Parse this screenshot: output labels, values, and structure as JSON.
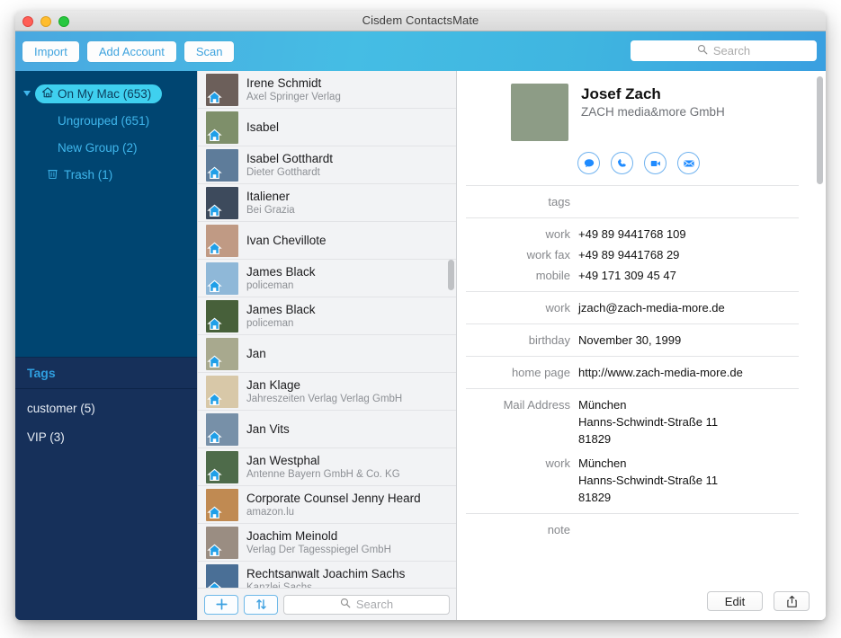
{
  "window": {
    "title": "Cisdem ContactsMate",
    "controls": [
      "close",
      "minimize",
      "zoom"
    ]
  },
  "toolbar": {
    "import_label": "Import",
    "add_account_label": "Add Account",
    "scan_label": "Scan",
    "search_placeholder": "Search",
    "search_value": "",
    "accent": "#45bde4"
  },
  "sidebar": {
    "bg": "#004571",
    "tags_bg": "#16305a",
    "accent_text": "#3fb6ec",
    "selected_chip_bg": "#3fd0ef",
    "groups": [
      {
        "label": "On My Mac (653)",
        "icon": "house-icon",
        "selected": true
      },
      {
        "label": "Ungrouped (651)",
        "selected": false
      },
      {
        "label": "New Group (2)",
        "selected": false
      },
      {
        "label": "Trash (1)",
        "icon": "trash-icon",
        "selected": false
      }
    ],
    "tags_header": "Tags",
    "tags": [
      {
        "label": "customer (5)"
      },
      {
        "label": "VIP (3)"
      }
    ]
  },
  "contact_list": {
    "items": [
      {
        "name": "Irene Schmidt",
        "org": "Axel Springer Verlag",
        "thumb": "#6c5f5a"
      },
      {
        "name": "Isabel",
        "org": "",
        "thumb": "#7e8f6a"
      },
      {
        "name": "Isabel Gotthardt",
        "org": "Dieter Gotthardt",
        "thumb": "#5e7c9a"
      },
      {
        "name": "Italiener",
        "org": "Bei Grazia",
        "thumb": "#3d4a5c"
      },
      {
        "name": "Ivan Chevillote",
        "org": "",
        "thumb": "#c09a84"
      },
      {
        "name": "James Black",
        "org": "policeman",
        "thumb": "#8fb8d8"
      },
      {
        "name": "James Black",
        "org": "policeman",
        "thumb": "#47603a"
      },
      {
        "name": "Jan",
        "org": "",
        "thumb": "#a8a98e"
      },
      {
        "name": "Jan Klage",
        "org": "Jahreszeiten Verlag Verlag GmbH",
        "thumb": "#d8c8a8"
      },
      {
        "name": "Jan Vits",
        "org": "",
        "thumb": "#7790a8"
      },
      {
        "name": "Jan Westphal",
        "org": "Antenne Bayern GmbH & Co. KG",
        "thumb": "#4e6b4a"
      },
      {
        "name": "Corporate Counsel Jenny Heard",
        "org": "amazon.lu",
        "thumb": "#c08a52"
      },
      {
        "name": "Joachim Meinold",
        "org": "Verlag Der Tagesspiegel GmbH",
        "thumb": "#9a8d82"
      },
      {
        "name": "Rechtsanwalt Joachim Sachs",
        "org": "Kanzlei Sachs",
        "thumb": "#4a6f96"
      }
    ],
    "add_button": "add-contact-button",
    "sort_button": "sort-button",
    "search_placeholder": "Search",
    "search_value": ""
  },
  "detail": {
    "name": "Josef Zach",
    "organization": "ZACH media&more GmbH",
    "avatar_color": "#8d9c86",
    "actions": [
      {
        "icon": "message-icon",
        "name": "message-action"
      },
      {
        "icon": "phone-icon",
        "name": "call-action"
      },
      {
        "icon": "video-icon",
        "name": "video-call-action"
      },
      {
        "icon": "mail-icon",
        "name": "email-action"
      }
    ],
    "groups": [
      {
        "rows": [
          {
            "label": "tags",
            "value": ""
          }
        ]
      },
      {
        "rows": [
          {
            "label": "work",
            "value": "+49 89 9441768 109"
          },
          {
            "label": "work fax",
            "value": "+49 89 9441768 29"
          },
          {
            "label": "mobile",
            "value": "+49 171 309 45 47"
          }
        ]
      },
      {
        "rows": [
          {
            "label": "work",
            "value": "jzach@zach-media-more.de"
          }
        ]
      },
      {
        "rows": [
          {
            "label": "birthday",
            "value": "November 30, 1999"
          }
        ]
      },
      {
        "rows": [
          {
            "label": "home page",
            "value": "http://www.zach-media-more.de"
          }
        ]
      },
      {
        "rows": [
          {
            "label": "Mail Address",
            "value": "München\nHanns-Schwindt-Straße 11\n81829"
          },
          {
            "label": "",
            "value": ""
          },
          {
            "label": "work",
            "value": "München\nHanns-Schwindt-Straße 11\n81829"
          }
        ]
      },
      {
        "rows": [
          {
            "label": "note",
            "value": ""
          }
        ]
      }
    ],
    "edit_label": "Edit",
    "share_icon": "share-icon"
  }
}
